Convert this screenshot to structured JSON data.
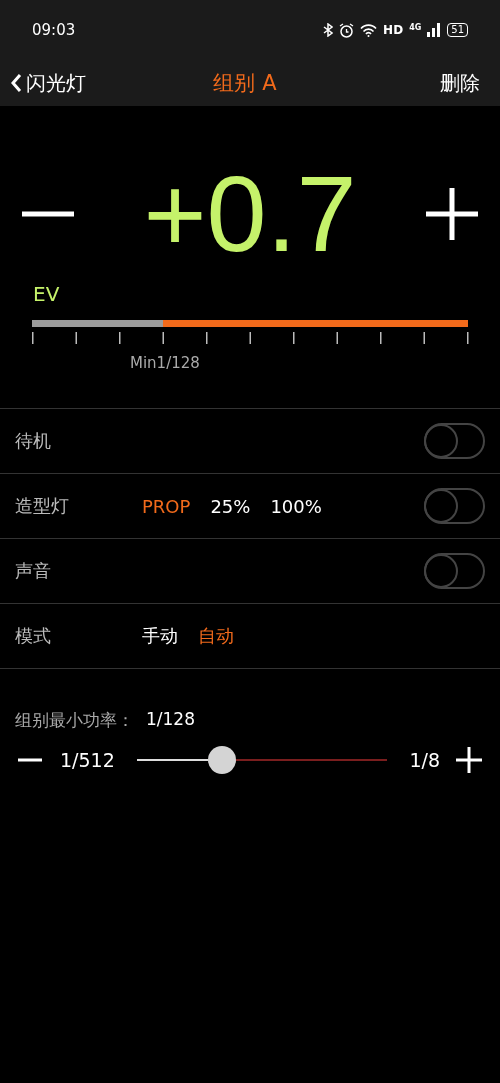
{
  "status_bar": {
    "time": "09:03",
    "network_label": "HD",
    "cell_label": "4G",
    "battery": "51"
  },
  "nav": {
    "back": "闪光灯",
    "title": "组别 A",
    "action": "删除"
  },
  "ev": {
    "value": "+0.7",
    "label": "EV",
    "min_label": "Min1/128",
    "scale": {
      "level": 0.3
    }
  },
  "settings": [
    {
      "kind": "toggle",
      "label": "待机",
      "on": false
    },
    {
      "kind": "options",
      "label": "造型灯",
      "options": [
        {
          "label": "PROP",
          "selected": true
        },
        {
          "label": "25%",
          "selected": false
        },
        {
          "label": "100%",
          "selected": false
        }
      ],
      "toggle_on": false
    },
    {
      "kind": "toggle",
      "label": "声音",
      "on": false
    },
    {
      "kind": "options",
      "label": "模式",
      "options": [
        {
          "label": "手动",
          "selected": false
        },
        {
          "label": "自动",
          "selected": true
        }
      ]
    }
  ],
  "min_power": {
    "label": "组别最小功率：",
    "value": "1/128",
    "min": "1/512",
    "max": "1/8",
    "level": 0.34
  }
}
